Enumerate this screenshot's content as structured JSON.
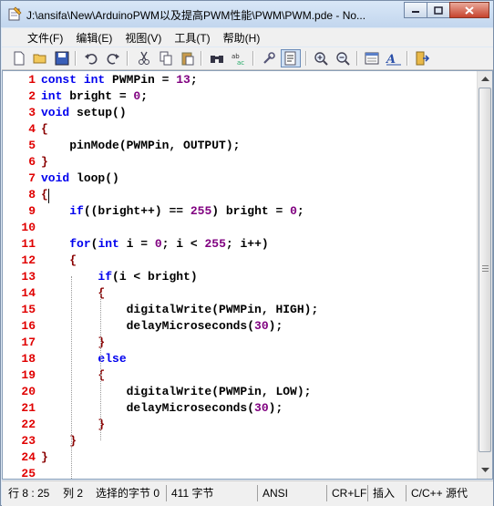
{
  "window": {
    "title": "J:\\ansifa\\New\\ArduinoPWM以及提高PWM性能\\PWM\\PWM.pde - No..."
  },
  "menu": {
    "items": [
      "文件(F)",
      "编辑(E)",
      "视图(V)",
      "工具(T)",
      "帮助(H)"
    ]
  },
  "toolbar": {
    "icons": [
      "new-file-icon",
      "open-folder-icon",
      "save-icon",
      "undo-icon",
      "redo-icon",
      "cut-icon",
      "copy-icon",
      "paste-icon",
      "find-icon",
      "replace-icon",
      "wrap-icon",
      "show-whitespace-icon",
      "zoom-in-icon",
      "zoom-out-icon",
      "view-icon",
      "font-icon",
      "exit-icon"
    ]
  },
  "editor": {
    "lines": [
      {
        "n": "1",
        "code": "const int PWMPin = 13;"
      },
      {
        "n": "2",
        "code": "int bright = 0;"
      },
      {
        "n": "3",
        "code": "void setup()"
      },
      {
        "n": "4",
        "code": "{"
      },
      {
        "n": "5",
        "code": "    pinMode(PWMPin, OUTPUT);"
      },
      {
        "n": "6",
        "code": "}"
      },
      {
        "n": "7",
        "code": "void loop()"
      },
      {
        "n": "8",
        "code": "{"
      },
      {
        "n": "9",
        "code": "    if((bright++) == 255) bright = 0;"
      },
      {
        "n": "10",
        "code": ""
      },
      {
        "n": "11",
        "code": "    for(int i = 0; i < 255; i++)"
      },
      {
        "n": "12",
        "code": "    {"
      },
      {
        "n": "13",
        "code": "        if(i < bright)"
      },
      {
        "n": "14",
        "code": "        {"
      },
      {
        "n": "15",
        "code": "            digitalWrite(PWMPin, HIGH);"
      },
      {
        "n": "16",
        "code": "            delayMicroseconds(30);"
      },
      {
        "n": "17",
        "code": "        }"
      },
      {
        "n": "18",
        "code": "        else"
      },
      {
        "n": "19",
        "code": "        {"
      },
      {
        "n": "20",
        "code": "            digitalWrite(PWMPin, LOW);"
      },
      {
        "n": "21",
        "code": "            delayMicroseconds(30);"
      },
      {
        "n": "22",
        "code": "        }"
      },
      {
        "n": "23",
        "code": "    }"
      },
      {
        "n": "24",
        "code": "}"
      },
      {
        "n": "25",
        "code": ""
      }
    ]
  },
  "status": {
    "position": "行 8 : 25",
    "column": "列 2",
    "selected": "选择的字节 0",
    "size": "411 字节",
    "encoding": "ANSI",
    "line_ending": "CR+LF",
    "mode": "插入",
    "syntax": "C/C++ 源代"
  },
  "colors": {
    "line_number": "#e00000",
    "keyword": "#0000ee",
    "number": "#800080"
  }
}
